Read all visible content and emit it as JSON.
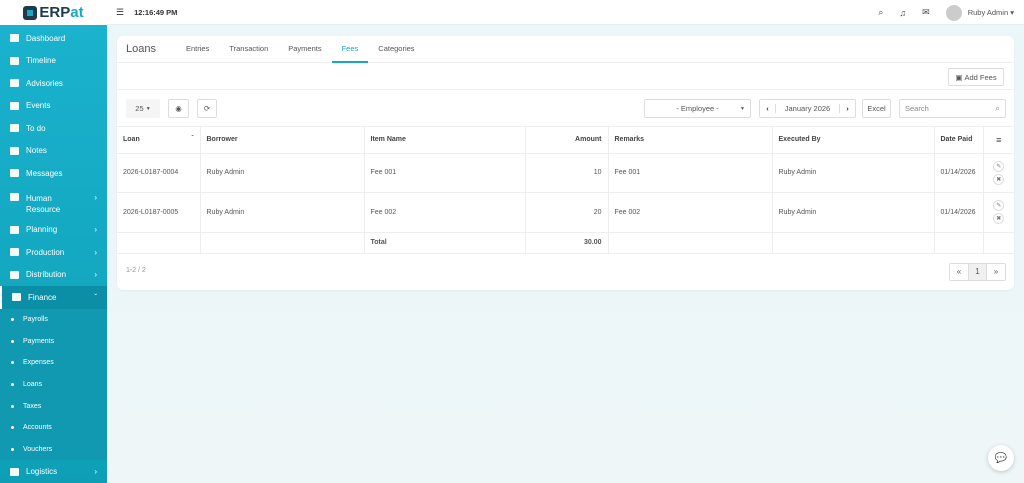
{
  "app": {
    "logo_prefix": "ERP",
    "logo_suffix": "at",
    "time": "12:16:49 PM",
    "user": "Ruby Admin"
  },
  "sidebar": {
    "items": [
      {
        "label": "Dashboard",
        "icon": "dashboard-icon"
      },
      {
        "label": "Timeline",
        "icon": "timeline-icon"
      },
      {
        "label": "Advisories",
        "icon": "megaphone-icon"
      },
      {
        "label": "Events",
        "icon": "calendar-icon"
      },
      {
        "label": "To do",
        "icon": "checkbox-icon"
      },
      {
        "label": "Notes",
        "icon": "note-icon"
      },
      {
        "label": "Messages",
        "icon": "envelope-icon"
      },
      {
        "label": "Human Resource",
        "icon": "users-icon"
      },
      {
        "label": "Planning",
        "icon": "briefcase-icon"
      },
      {
        "label": "Production",
        "icon": "production-icon"
      },
      {
        "label": "Distribution",
        "icon": "bank-icon"
      },
      {
        "label": "Finance",
        "icon": "money-icon"
      },
      {
        "label": "Logistics",
        "icon": "truck-icon"
      }
    ],
    "finance_sub": [
      "Payrolls",
      "Payments",
      "Expenses",
      "Loans",
      "Taxes",
      "Accounts",
      "Vouchers"
    ]
  },
  "page": {
    "title": "Loans",
    "tabs": [
      "Entries",
      "Transaction",
      "Payments",
      "Fees",
      "Categories"
    ],
    "active_tab": "Fees",
    "add_label": "Add Fees"
  },
  "toolbar": {
    "page_size": "25",
    "employee_placeholder": "- Employee -",
    "month": "January 2026",
    "excel": "Excel",
    "search_placeholder": "Search"
  },
  "table": {
    "headers": [
      "Loan",
      "Borrower",
      "Item Name",
      "Amount",
      "Remarks",
      "Executed By",
      "Date Paid"
    ],
    "rows": [
      [
        "2026-L0187-0004",
        "Ruby Admin",
        "Fee 001",
        "10",
        "Fee 001",
        "Ruby Admin",
        "01/14/2026"
      ],
      [
        "2026-L0187-0005",
        "Ruby Admin",
        "Fee 002",
        "20",
        "Fee 002",
        "Ruby Admin",
        "01/14/2026"
      ]
    ],
    "total_label": "Total",
    "total_value": "30.00"
  },
  "footer": {
    "range": "1-2 / 2",
    "page": "1",
    "prev": "«",
    "next": "»"
  }
}
